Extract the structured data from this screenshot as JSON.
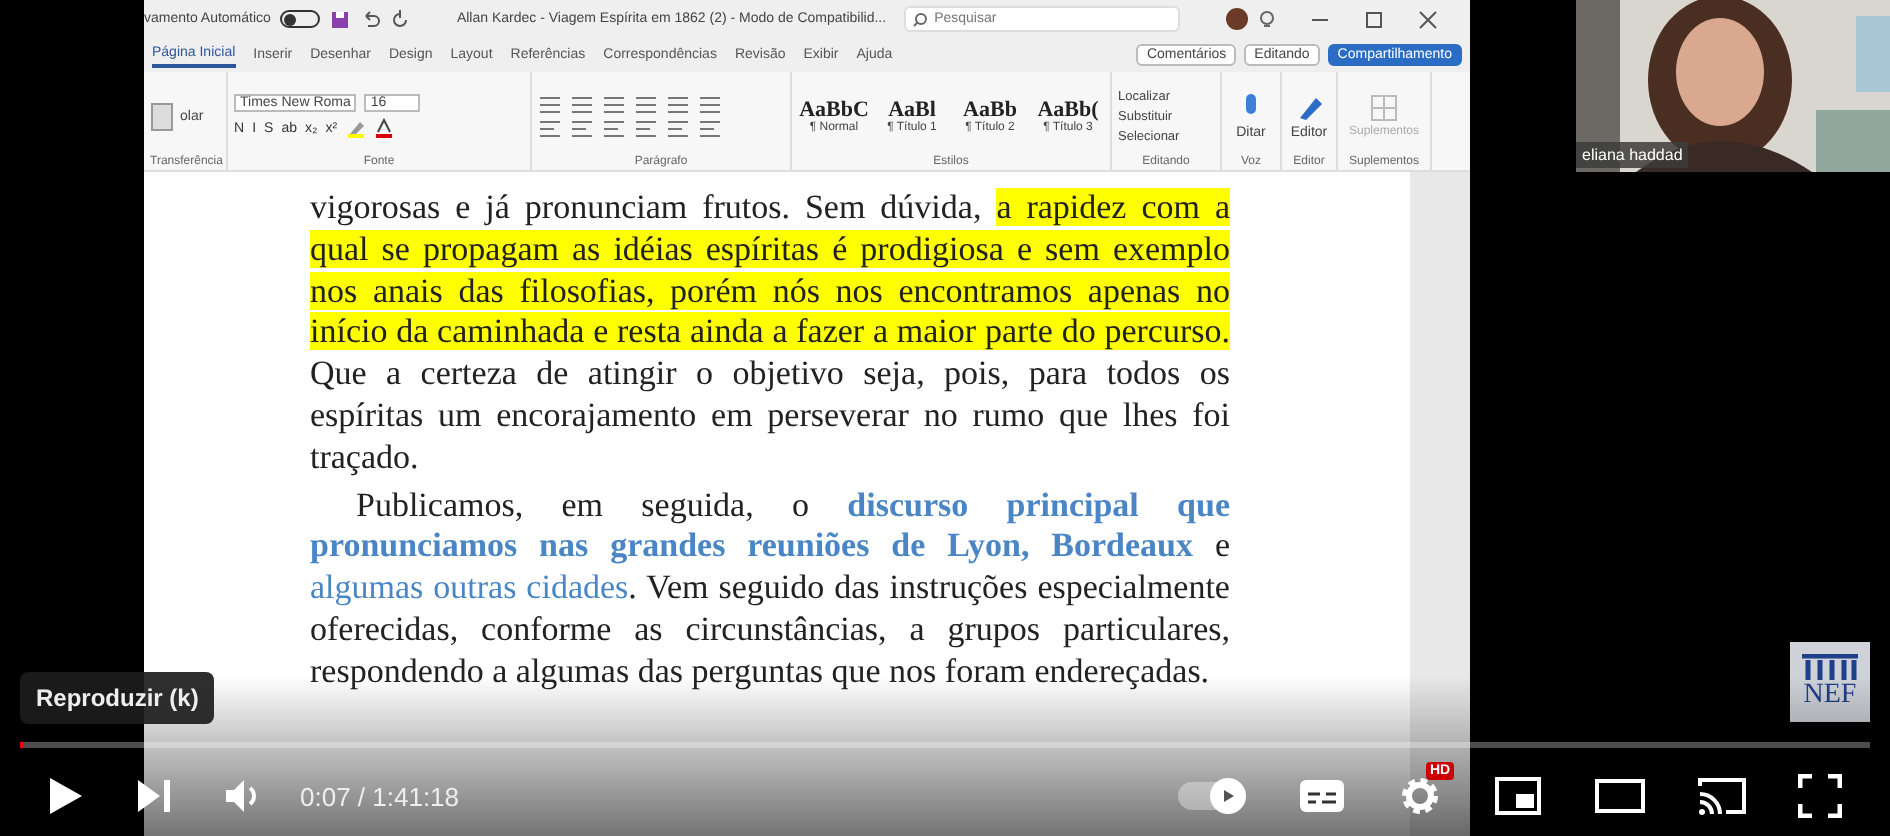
{
  "word": {
    "autosave_label": "vamento Automático",
    "autosave_on": false,
    "title": "Allan Kardec - Viagem Espírita em 1862 (2) - Modo de Compatibilid...",
    "search_placeholder": "Pesquisar",
    "tabs": [
      {
        "label": "Página Inicial",
        "selected": true
      },
      {
        "label": "Inserir",
        "selected": false
      },
      {
        "label": "Desenhar",
        "selected": false
      },
      {
        "label": "Design",
        "selected": false
      },
      {
        "label": "Layout",
        "selected": false
      },
      {
        "label": "Referências",
        "selected": false
      },
      {
        "label": "Correspondências",
        "selected": false
      },
      {
        "label": "Revisão",
        "selected": false
      },
      {
        "label": "Exibir",
        "selected": false
      },
      {
        "label": "Ajuda",
        "selected": false
      }
    ],
    "actions": [
      {
        "label": "Comentários",
        "kind": "outline"
      },
      {
        "label": "Editando",
        "kind": "dropdown"
      },
      {
        "label": "Compartilhamento",
        "kind": "primary"
      }
    ],
    "paste_label": "olar",
    "font_family": "Times New Roma",
    "font_size": "16",
    "format_buttons": [
      "N",
      "I",
      "S",
      "ab",
      "x₂",
      "x²"
    ],
    "styles": [
      {
        "sample": "AaBbC",
        "name": "¶ Normal"
      },
      {
        "sample": "AaBl",
        "name": "¶ Título 1"
      },
      {
        "sample": "AaBb",
        "name": "¶ Título 2"
      },
      {
        "sample": "AaBb(",
        "name": "¶ Título 3"
      }
    ],
    "editing": [
      "Localizar",
      "Substituir",
      "Selecionar"
    ],
    "voice": "Ditar",
    "editor": "Editor",
    "addins": "Suplementos",
    "groups": [
      "Transferência",
      "Fonte",
      "Parágrafo",
      "Estilos",
      "Editando",
      "Voz",
      "Editor",
      "Suplementos"
    ]
  },
  "document": {
    "paragraphs": [
      {
        "indent": false,
        "segments": [
          {
            "kind": "plain",
            "text": "vigorosas e já pronunciam frutos. Sem dúvida, "
          },
          {
            "kind": "highlight",
            "text": "a rapidez com a qual se propagam as idéias espíritas é prodigiosa e sem exemplo nos anais das filosofias, porém nós nos encontramos apenas no início da caminhada e resta ainda a fazer a maior parte do percurso."
          },
          {
            "kind": "plain",
            "text": " Que a certeza de atingir o objetivo seja, pois, para todos os espíritas um encorajamento em perseverar no rumo que lhes foi traçado."
          }
        ]
      },
      {
        "indent": true,
        "segments": [
          {
            "kind": "plain",
            "text": "Publicamos, em seguida, o "
          },
          {
            "kind": "link-bold",
            "text": "discurso principal que pronunciamos nas grandes reuniões de Lyon, Bordeaux"
          },
          {
            "kind": "plain",
            "text": " e "
          },
          {
            "kind": "link",
            "text": "algumas outras cidades"
          },
          {
            "kind": "plain",
            "text": ". Vem seguido das instruções especialmente oferecidas, conforme as circunstâncias, a grupos particulares, respondendo a algumas das perguntas que nos foram endereçadas."
          }
        ]
      }
    ]
  },
  "webcam": {
    "name": "eliana haddad"
  },
  "logo": "NEF",
  "player": {
    "tooltip": "Reproduzir (k)",
    "time": "0:07 / 1:41:18",
    "level": 0.002,
    "autoplay_on": true,
    "quality_badge": "HD"
  }
}
